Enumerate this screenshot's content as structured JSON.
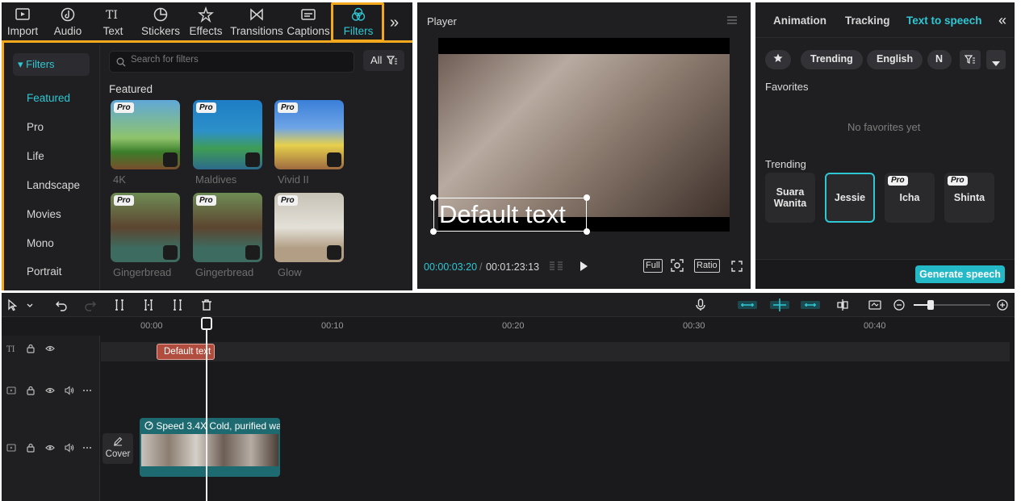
{
  "toolbar": {
    "items": [
      {
        "label": "Import",
        "icon": "import-icon"
      },
      {
        "label": "Audio",
        "icon": "audio-icon"
      },
      {
        "label": "Text",
        "icon": "text-icon"
      },
      {
        "label": "Stickers",
        "icon": "stickers-icon"
      },
      {
        "label": "Effects",
        "icon": "effects-icon"
      },
      {
        "label": "Transitions",
        "icon": "transitions-icon"
      },
      {
        "label": "Captions",
        "icon": "captions-icon"
      },
      {
        "label": "Filters",
        "icon": "filters-icon",
        "active": true
      }
    ],
    "more": "»"
  },
  "filters": {
    "header": "▾ Filters",
    "categories": [
      "Featured",
      "Pro",
      "Life",
      "Landscape",
      "Movies",
      "Mono",
      "Portrait"
    ],
    "selected_category": "Featured",
    "search_placeholder": "Search for filters",
    "all_label": "All",
    "section_title": "Featured",
    "items": [
      {
        "name": "4K",
        "badge": "Pro"
      },
      {
        "name": "Maldives",
        "badge": "Pro"
      },
      {
        "name": "Vivid II",
        "badge": "Pro"
      },
      {
        "name": "Gingerbread",
        "badge": "Pro"
      },
      {
        "name": "Gingerbread",
        "badge": "Pro"
      },
      {
        "name": "Glow",
        "badge": "Pro"
      }
    ]
  },
  "player": {
    "title": "Player",
    "overlay_text": "Default text",
    "time_current": "00:00:03:20",
    "time_separator": "/",
    "time_total": "00:01:23:13",
    "buttons": {
      "full": "Full",
      "ratio": "Ratio"
    }
  },
  "tts": {
    "tabs": [
      "Animation",
      "Tracking",
      "Text to speech"
    ],
    "active_tab": "Text to speech",
    "collapse": "«",
    "chips": [
      "Trending",
      "English",
      "N"
    ],
    "favorites_title": "Favorites",
    "no_favorites": "No favorites yet",
    "trending_title": "Trending",
    "voices": [
      {
        "name": "Suara Wanita",
        "badge": ""
      },
      {
        "name": "Jessie",
        "badge": "",
        "selected": true
      },
      {
        "name": "Icha",
        "badge": "Pro"
      },
      {
        "name": "Shinta",
        "badge": "Pro"
      }
    ],
    "generate_label": "Generate speech"
  },
  "timeline": {
    "ticks": [
      "00:00",
      "00:10",
      "00:20",
      "00:30",
      "00:40"
    ],
    "text_clip_label": "Default text",
    "video_clip_label": "Speed 3.4X  Cold, purified wa",
    "cover_label": "Cover"
  },
  "colors": {
    "accent": "#2fc7d4",
    "highlight": "#f4a81d",
    "text_clip": "#b04d3e",
    "video_clip": "#1d6a70"
  }
}
